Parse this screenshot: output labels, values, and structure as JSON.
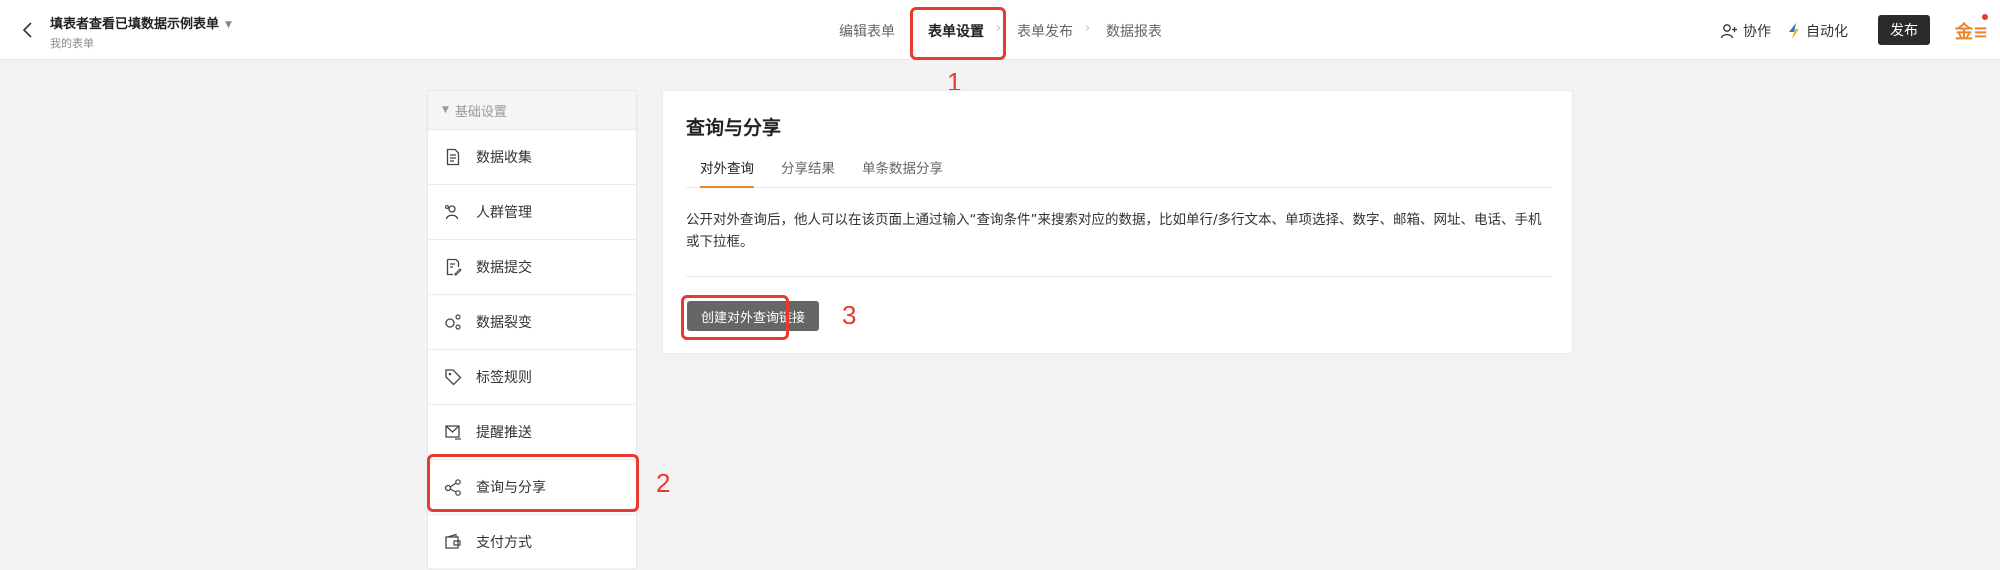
{
  "header": {
    "title": "填表者查看已填数据示例表单",
    "subtitle": "我的表单",
    "steps": [
      {
        "label": "编辑表单"
      },
      {
        "label": "表单设置"
      },
      {
        "label": "表单发布"
      },
      {
        "label": "数据报表"
      }
    ],
    "arrow": "›",
    "collaborate_label": "协作",
    "automation_label": "自动化",
    "publish_label": "发布",
    "logo_text": "金≡"
  },
  "annotations": {
    "n1": "1",
    "n2": "2",
    "n3": "3",
    "highlight_color": "#e63b2e"
  },
  "sidebar": {
    "group_label": "基础设置",
    "items": [
      {
        "label": "数据收集",
        "icon": "document-icon"
      },
      {
        "label": "人群管理",
        "icon": "user-group-icon"
      },
      {
        "label": "数据提交",
        "icon": "edit-document-icon"
      },
      {
        "label": "数据裂变",
        "icon": "share-nodes-icon"
      },
      {
        "label": "标签规则",
        "icon": "tag-icon"
      },
      {
        "label": "提醒推送",
        "icon": "mail-send-icon"
      },
      {
        "label": "查询与分享",
        "icon": "share-icon"
      },
      {
        "label": "支付方式",
        "icon": "wallet-icon"
      }
    ]
  },
  "main": {
    "title": "查询与分享",
    "tabs": [
      {
        "label": "对外查询"
      },
      {
        "label": "分享结果"
      },
      {
        "label": "单条数据分享"
      }
    ],
    "description": "公开对外查询后，他人可以在该页面上通过输入“查询条件”来搜索对应的数据，比如单行/多行文本、单项选择、数字、邮箱、网址、电话、手机或下拉框。",
    "create_button_label": "创建对外查询链接"
  },
  "colors": {
    "accent": "#e8862b",
    "publish_bg": "#2b2b2b",
    "button_gray": "#666666"
  }
}
